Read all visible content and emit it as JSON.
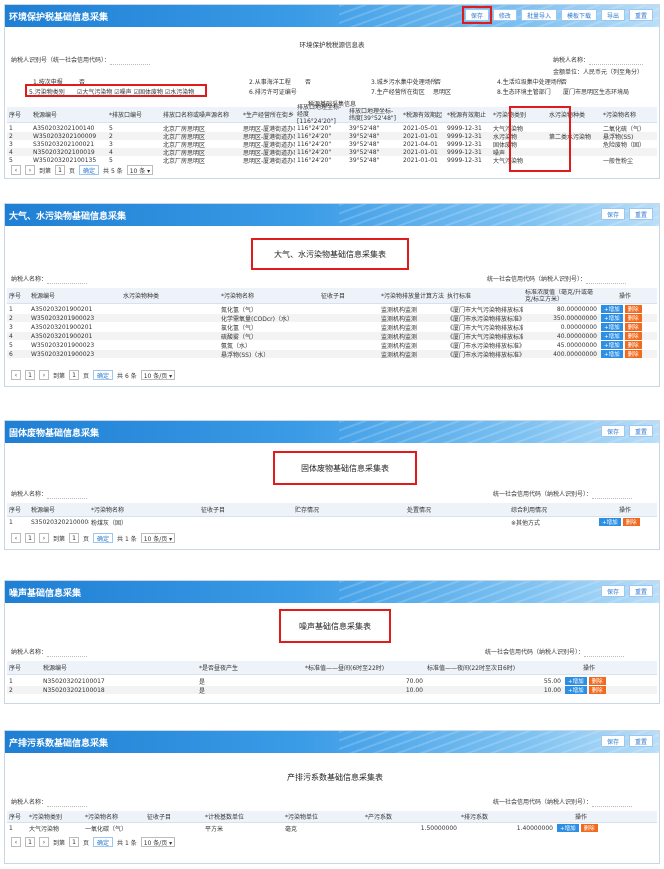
{
  "p1": {
    "title": "环境保护税基础信息采集",
    "buttons": [
      "保存",
      "修改",
      "批量导入",
      "模板下载",
      "导出",
      "重置"
    ],
    "form_title": "环境保护税税源信息表",
    "taxpayer_id_label": "纳税人识别号（统一社会信用代码）：",
    "taxpayer_name_label": "纳税人名称：",
    "unit_note": "金额单位：人民币元（列至角分）",
    "q1": "1.按次申报",
    "q1v": "否",
    "q2": "2.从事海洋工程",
    "q2v": "否",
    "q3": "3.城乡污水集中处理场所",
    "q3v": "否",
    "q4": "4.生活垃圾集中处理场所",
    "q4v": "否",
    "q5": "5.污染物类别",
    "q5v": "☑大气污染物  ☑噪声  ☑固体废物  ☑水污染物",
    "q6": "6.排污许可证编号",
    "q7": "7.生产经营所在街区",
    "q7v": "思明区",
    "q8": "8.生态环境主管部门",
    "q8v": "厦门市思明区生态环境局",
    "group_header": "税源基础采集信息",
    "headers": [
      "序号",
      "税源编号",
      "*排放口编号",
      "排放口名称或噪声源名称",
      "*生产经营所在街乡",
      "排放口地理坐标-经度[116°24'20\"]",
      "排放口地理坐标-纬度[39°52'48\"]",
      "*税源有效期起",
      "*税源有效期止",
      "*污染物类别",
      "水污染物种类",
      "*污染物名称"
    ],
    "rows": [
      [
        "1",
        "A350203202100140",
        "5",
        "北京厂房思明区",
        "思明区-厦港街道办事处",
        "116°24'20\"",
        "39°52'48\"",
        "2021-05-01",
        "9999-12-31",
        "大气污染物",
        "",
        "二氧化硫（气）"
      ],
      [
        "2",
        "W350203202100009",
        "2",
        "北京厂房思明区",
        "思明区-厦港街道办事处",
        "116°24'20\"",
        "39°52'48\"",
        "2021-01-01",
        "9999-12-31",
        "水污染物",
        "第二类水污染物",
        "悬浮物(SS)"
      ],
      [
        "3",
        "S350203202100021",
        "3",
        "北京厂房思明区",
        "思明区-厦港街道办事处",
        "116°24'20\"",
        "39°52'48\"",
        "2021-04-01",
        "9999-12-31",
        "固体废物",
        "",
        "危险废物（固）"
      ],
      [
        "4",
        "N350203202100019",
        "4",
        "北京厂房思明区",
        "思明区-厦港街道办事处",
        "116°24'20\"",
        "39°52'48\"",
        "2021-01-01",
        "9999-12-31",
        "噪声",
        "",
        ""
      ],
      [
        "5",
        "W350203202100135",
        "5",
        "北京厂房思明区",
        "思明区-厦港街道办事处",
        "116°24'20\"",
        "39°52'48\"",
        "2021-01-01",
        "9999-12-31",
        "大气污染物",
        "",
        "一般性粉尘"
      ]
    ],
    "pager": {
      "goto": "到第",
      "page": "1",
      "page_unit": "页",
      "confirm": "确定",
      "total": "共 5 条",
      "size": "10 条 ▾"
    }
  },
  "p2": {
    "title": "大气、水污染物基础信息采集",
    "buttons": [
      "保存",
      "重置"
    ],
    "form_title": "大气、水污染物基础信息采集表",
    "taxpayer_name_label": "纳税人名称：",
    "credit_label": "统一社会信用代码（纳税人识别号）：",
    "headers": [
      "序号",
      "税源编号",
      "水污染物种类",
      "*污染物名称",
      "征收子目",
      "*污染物排放量计算方法",
      "执行标准",
      "标准浓度值（毫克/升或毫克/标立方米）",
      "操作"
    ],
    "rows": [
      [
        "1",
        "A350203201900201",
        "",
        "氮化氢（气）",
        "",
        "监测机构监测",
        "《厦门市大气污染物排放标准》",
        "80.00000000"
      ],
      [
        "2",
        "W350203201900023",
        "",
        "化学需氧量(CODcr)（水）",
        "",
        "监测机构监测",
        "《厦门市水污染物排放标准》（",
        "350.00000000"
      ],
      [
        "3",
        "A350203201900201",
        "",
        "氯化氢（气）",
        "",
        "监测机构监测",
        "《厦门市大气污染物排放标准》",
        "0.00000000"
      ],
      [
        "4",
        "A350203201900201",
        "",
        "硫酸雾（气）",
        "",
        "监测机构监测",
        "《厦门市大气污染物排放标准》",
        "40.00000000"
      ],
      [
        "5",
        "W350203201900023",
        "",
        "氨氮（水）",
        "",
        "监测机构监测",
        "《厦门市水污染物排放标准》（",
        "45.00000000"
      ],
      [
        "6",
        "W350203201900023",
        "",
        "悬浮物(SS)（水）",
        "",
        "监测机构监测",
        "《厦门市水污染物排放标准》（",
        "400.00000000"
      ]
    ],
    "add": "+增加",
    "del": "删除",
    "pager": {
      "goto": "到第",
      "page": "1",
      "page_unit": "页",
      "confirm": "确定",
      "total": "共 6 条",
      "size": "10 条/页 ▾"
    }
  },
  "p3": {
    "title": "固体废物基础信息采集",
    "buttons": [
      "保存",
      "重置"
    ],
    "form_title": "固体废物基础信息采集表",
    "taxpayer_name_label": "纳税人名称：",
    "credit_label": "统一社会信用代码（纳税人识别号）：",
    "headers": [
      "序号",
      "税源编号",
      "*污染物名称",
      "征收子目",
      "贮存情况",
      "处置情况",
      "综合利用情况",
      "操作"
    ],
    "rows": [
      [
        "1",
        "S350203202100008",
        "粉煤灰（固）",
        "",
        "",
        "",
        "※其他方式",
        ""
      ]
    ],
    "add": "+增加",
    "del": "删除",
    "pager": {
      "goto": "到第",
      "page": "1",
      "page_unit": "页",
      "confirm": "确定",
      "total": "共 1 条",
      "size": "10 条/页 ▾"
    }
  },
  "p4": {
    "title": "噪声基础信息采集",
    "buttons": [
      "保存",
      "重置"
    ],
    "form_title": "噪声基础信息采集表",
    "taxpayer_name_label": "纳税人名称：",
    "credit_label": "统一社会信用代码（纳税人识别号）：",
    "headers": [
      "序号",
      "税源编号",
      "*是否昼夜产生",
      "*标准值——昼间(6时至22时)",
      "标准值——夜间(22时至次日6时)",
      "操作"
    ],
    "rows": [
      [
        "1",
        "N350203202100017",
        "是",
        "70.00",
        "55.00"
      ],
      [
        "2",
        "N350203202100018",
        "是",
        "10.00",
        "10.00"
      ]
    ],
    "add": "+增加",
    "del": "删除"
  },
  "p5": {
    "title": "产排污系数基础信息采集",
    "buttons": [
      "保存",
      "重置"
    ],
    "form_title": "产排污系数基础信息采集表",
    "taxpayer_name_label": "纳税人名称：",
    "credit_label": "统一社会信用代码（纳税人识别号）：",
    "headers": [
      "序号",
      "*污染物类别",
      "*污染物名称",
      "征收子目",
      "*计税基数单位",
      "*污染物单位",
      "*产污系数",
      "*排污系数",
      "操作"
    ],
    "rows": [
      [
        "1",
        "大气污染物",
        "一氧化碳（气）",
        "",
        "平方米",
        "毫克",
        "1.50000000",
        "1.40000000"
      ]
    ],
    "add": "+增加",
    "del": "删除",
    "pager": {
      "goto": "到第",
      "page": "1",
      "page_unit": "页",
      "confirm": "确定",
      "total": "共 1 条",
      "size": "10 条/页 ▾"
    }
  }
}
